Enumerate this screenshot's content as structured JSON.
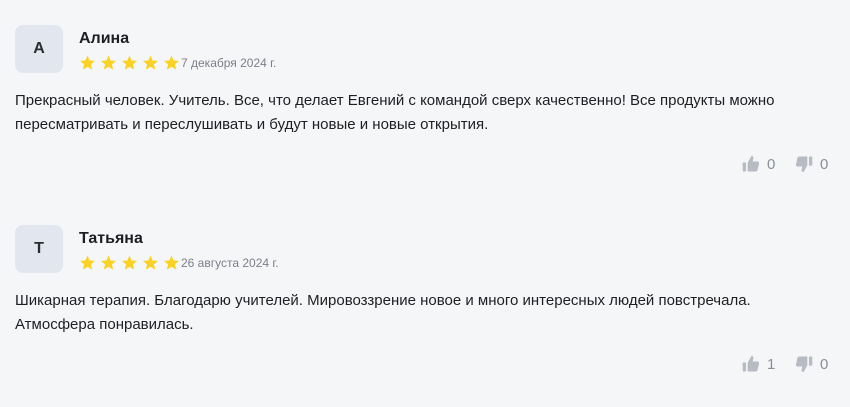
{
  "reviews": [
    {
      "initial": "А",
      "author": "Алина",
      "rating": 5,
      "date": "7 декабря 2024 г.",
      "text_line1": "Прекрасный человек. Учитель. Все, что делает Евгений с командой сверх качественно! Все продукты можно",
      "text_line2": "пересматривать и переслушивать и будут новые и новые открытия.",
      "likes": "0",
      "dislikes": "0"
    },
    {
      "initial": "Т",
      "author": "Татьяна",
      "rating": 5,
      "date": "26 августа 2024 г.",
      "text_line1": "Шикарная терапия. Благодарю учителей. Мировоззрение новое и много интересных людей повстречала.",
      "text_line2": "Атмосфера понравилась.",
      "likes": "1",
      "dislikes": "0"
    }
  ],
  "colors": {
    "star": "#fbd223",
    "avatar_bg": "#e2e6ee",
    "vote_icon": "#b7bbc3",
    "background": "#f5f6f8"
  },
  "icons": {
    "rating": "star-icon",
    "like": "thumbs-up-icon",
    "dislike": "thumbs-down-icon"
  }
}
